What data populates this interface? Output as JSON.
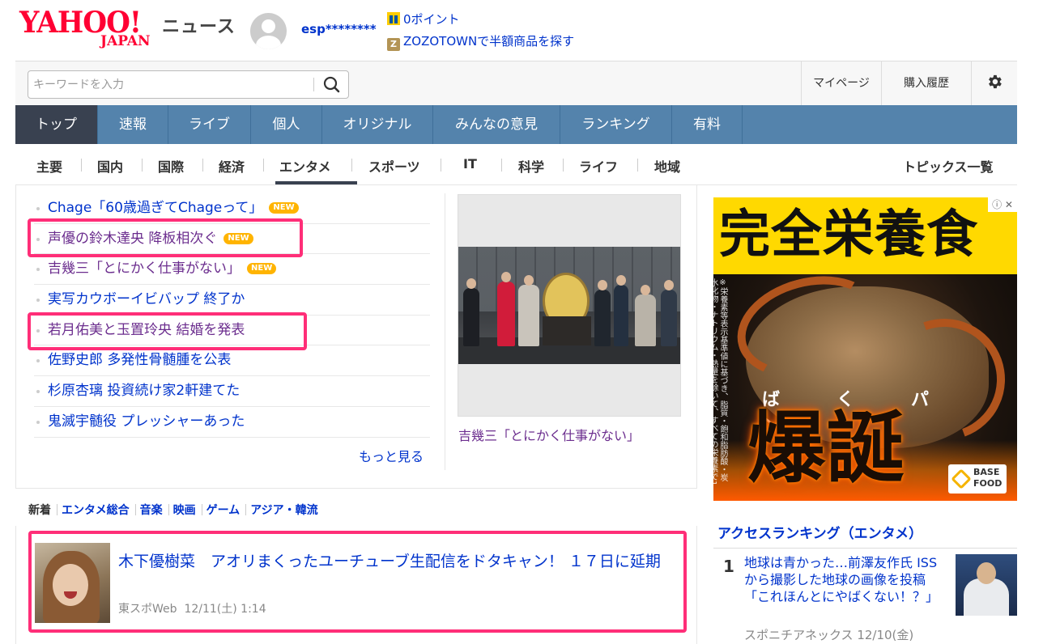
{
  "header": {
    "logo_main": "YAHOO!",
    "logo_sub": "JAPAN",
    "service": "ニュース",
    "username": "esp********",
    "promos": [
      {
        "icon": "tpoint-icon",
        "label": "0ポイント"
      },
      {
        "icon": "zozotown-icon",
        "label": "ZOZOTOWNで半額商品を探す"
      }
    ]
  },
  "search": {
    "placeholder": "キーワードを入力",
    "value": ""
  },
  "utility": {
    "mypage": "マイページ",
    "history": "購入履歴",
    "settings_icon": "gear-icon"
  },
  "main_nav": [
    {
      "label": "トップ",
      "active": true
    },
    {
      "label": "速報"
    },
    {
      "label": "ライブ"
    },
    {
      "label": "個人"
    },
    {
      "label": "オリジナル"
    },
    {
      "label": "みんなの意見"
    },
    {
      "label": "ランキング"
    },
    {
      "label": "有料"
    }
  ],
  "sub_nav": {
    "items": [
      "主要",
      "国内",
      "国際",
      "経済",
      "エンタメ",
      "スポーツ",
      "IT",
      "科学",
      "ライフ",
      "地域"
    ],
    "active": "エンタメ",
    "topics_all": "トピックス一覧"
  },
  "topics": [
    {
      "title": "Chage「60歳過ぎてChageって」",
      "new": true,
      "visited": false
    },
    {
      "title": "声優の鈴木達央 降板相次ぐ",
      "new": true,
      "visited": true
    },
    {
      "title": "吉幾三「とにかく仕事がない」",
      "new": true,
      "visited": true
    },
    {
      "title": "実写カウボーイビバップ 終了か",
      "new": false,
      "visited": false
    },
    {
      "title": "若月佑美と玉置玲央 結婚を発表",
      "new": false,
      "visited": true
    },
    {
      "title": "佐野史郎 多発性骨髄腫を公表",
      "new": false,
      "visited": false
    },
    {
      "title": "杉原杏璃 投資続け家2軒建てた",
      "new": false,
      "visited": false
    },
    {
      "title": "鬼滅宇髄役 プレッシャーあった",
      "new": false,
      "visited": false
    }
  ],
  "new_badge": "NEW",
  "more": "もっと見る",
  "photo_caption": "吉幾三「とにかく仕事がない」",
  "categories": [
    "新着",
    "エンタメ総合",
    "音楽",
    "映画",
    "ゲーム",
    "アジア・韓流"
  ],
  "article": {
    "title": "木下優樹菜　アオリまくったユーチューブ生配信をドタキャン！ １７日に延期",
    "source": "東スポWeb",
    "date": "12/11(土) 1:14"
  },
  "ad": {
    "headline": "完全栄養食",
    "ruby": "ばくパン",
    "big": "爆誕",
    "side": "※栄養素等表示基準値に基づき、脂質・飽和脂肪酸・炭水化物・ナトリウム・熱量を除いて、すべての栄養素で1日分の基準値の1/3以上を含む",
    "brand": "BASE FOOD",
    "info_icon": "ⓘ ✕"
  },
  "ranking": {
    "title": "アクセスランキング（エンタメ）",
    "items": [
      {
        "rank": "1",
        "title": "地球は青かった…前澤友作氏 ISSから撮影した地球の画像を投稿「これほんとにやばくない！？」",
        "meta": "スポニチアネックス 12/10(金)"
      }
    ]
  },
  "colors": {
    "nav_bg": "#5483ac",
    "nav_active": "#394150",
    "link": "#0033cc",
    "visited": "#6b2d8e",
    "highlight": "#ff2e78",
    "brand": "#ff0033"
  }
}
